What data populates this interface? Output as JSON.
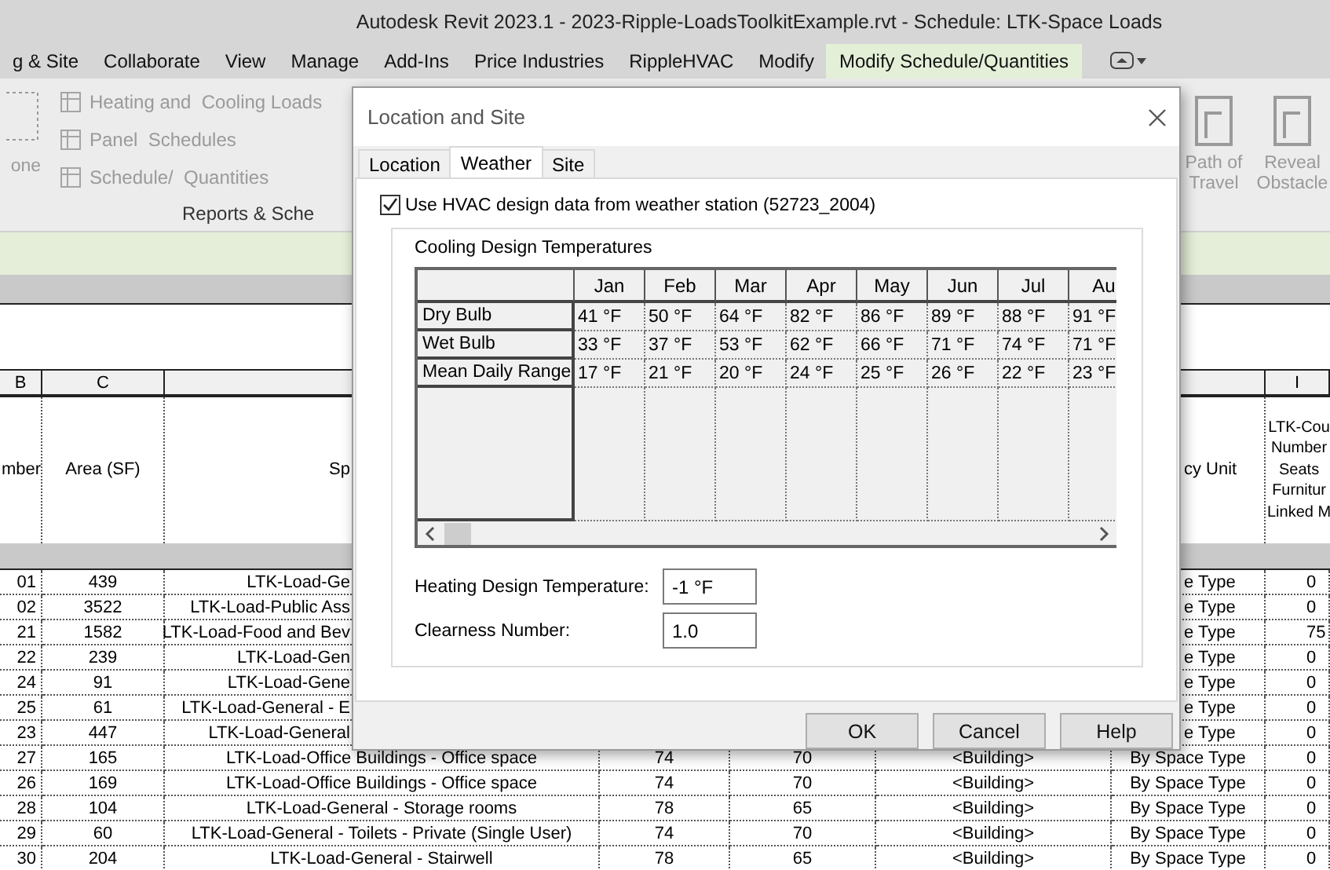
{
  "window": {
    "title": "Autodesk Revit 2023.1 - 2023-Ripple-LoadsToolkitExample.rvt - Schedule: LTK-Space Loads"
  },
  "ribbon_tabs": [
    {
      "label": "g & Site",
      "selected": false
    },
    {
      "label": "Collaborate",
      "selected": false
    },
    {
      "label": "View",
      "selected": false
    },
    {
      "label": "Manage",
      "selected": false
    },
    {
      "label": "Add-Ins",
      "selected": false
    },
    {
      "label": "Price Industries",
      "selected": false
    },
    {
      "label": "RippleHVAC",
      "selected": false
    },
    {
      "label": "Modify",
      "selected": false
    },
    {
      "label": "Modify Schedule/Quantities",
      "selected": true
    }
  ],
  "ribbon": {
    "left_tool": "one",
    "items": [
      {
        "label": "Heating and  Cooling Loads",
        "disabled": true
      },
      {
        "label": "Panel  Schedules",
        "disabled": true
      },
      {
        "label": "Schedule/  Quantities",
        "disabled": true
      }
    ],
    "panel_label": "Reports & Sche",
    "right_tools": [
      {
        "lines": [
          "Path of",
          "Travel"
        ]
      },
      {
        "lines": [
          "Reveal",
          "Obstacle"
        ]
      }
    ]
  },
  "schedule": {
    "letters": {
      "b": "B",
      "c": "C",
      "i": "I"
    },
    "headers": {
      "b": "mber",
      "c": "Area (SF)",
      "d": "Sp",
      "h": "cy Unit",
      "i": [
        "LTK-Cou",
        "Number",
        "Seats",
        "Furnitur",
        "Linked M"
      ]
    },
    "rows": [
      {
        "b": "01",
        "c": "439",
        "d": "LTK-Load-Ge",
        "h": "e Type",
        "i": "0"
      },
      {
        "b": "02",
        "c": "3522",
        "d": "LTK-Load-Public Ass",
        "h": "e Type",
        "i": "0"
      },
      {
        "b": "21",
        "c": "1582",
        "d": "LTK-Load-Food and Bev",
        "h": "e Type",
        "i": "75"
      },
      {
        "b": "22",
        "c": "239",
        "d": "LTK-Load-Gen",
        "h": "e Type",
        "i": "0"
      },
      {
        "b": "24",
        "c": "91",
        "d": "LTK-Load-Gene",
        "h": "e Type",
        "i": "0"
      },
      {
        "b": "25",
        "c": "61",
        "d": "LTK-Load-General - E",
        "h": "e Type",
        "i": "0"
      },
      {
        "b": "23",
        "c": "447",
        "d": "LTK-Load-General",
        "h": "e Type",
        "i": "0"
      },
      {
        "b": "27",
        "c": "165",
        "d": "LTK-Load-Office Buildings - Office space",
        "e": "74",
        "f": "70",
        "g": "<Building>",
        "h": "By Space Type",
        "i": "0"
      },
      {
        "b": "26",
        "c": "169",
        "d": "LTK-Load-Office Buildings - Office space",
        "e": "74",
        "f": "70",
        "g": "<Building>",
        "h": "By Space Type",
        "i": "0"
      },
      {
        "b": "28",
        "c": "104",
        "d": "LTK-Load-General - Storage rooms",
        "e": "78",
        "f": "65",
        "g": "<Building>",
        "h": "By Space Type",
        "i": "0"
      },
      {
        "b": "29",
        "c": "60",
        "d": "LTK-Load-General - Toilets - Private (Single User)",
        "e": "74",
        "f": "70",
        "g": "<Building>",
        "h": "By Space Type",
        "i": "0"
      },
      {
        "b": "30",
        "c": "204",
        "d": "LTK-Load-General - Stairwell",
        "e": "78",
        "f": "65",
        "g": "<Building>",
        "h": "By Space Type",
        "i": "0"
      }
    ]
  },
  "dialog": {
    "title": "Location and Site",
    "tabs": [
      {
        "label": "Location",
        "selected": false
      },
      {
        "label": "Weather",
        "selected": true
      },
      {
        "label": "Site",
        "selected": false
      }
    ],
    "checkbox": {
      "label": "Use HVAC design data from weather station (52723_2004)",
      "checked": true
    },
    "group_title": "Cooling Design Temperatures",
    "columns": [
      "Jan",
      "Feb",
      "Mar",
      "Apr",
      "May",
      "Jun",
      "Jul",
      "Au"
    ],
    "rows": [
      {
        "label": "Dry Bulb",
        "values": [
          "41 °F",
          "50 °F",
          "64 °F",
          "82 °F",
          "86 °F",
          "89 °F",
          "88 °F",
          "91 °F"
        ]
      },
      {
        "label": "Wet Bulb",
        "values": [
          "33 °F",
          "37 °F",
          "53 °F",
          "62 °F",
          "66 °F",
          "71 °F",
          "74 °F",
          "71 °F"
        ]
      },
      {
        "label": "Mean Daily Range",
        "values": [
          "17 °F",
          "21 °F",
          "20 °F",
          "24 °F",
          "25 °F",
          "26 °F",
          "22 °F",
          "23 °F"
        ]
      }
    ],
    "fields": [
      {
        "label": "Heating Design Temperature:",
        "value": "-1 °F"
      },
      {
        "label": "Clearness Number:",
        "value": "1.0"
      }
    ],
    "buttons": [
      "OK",
      "Cancel",
      "Help"
    ]
  }
}
